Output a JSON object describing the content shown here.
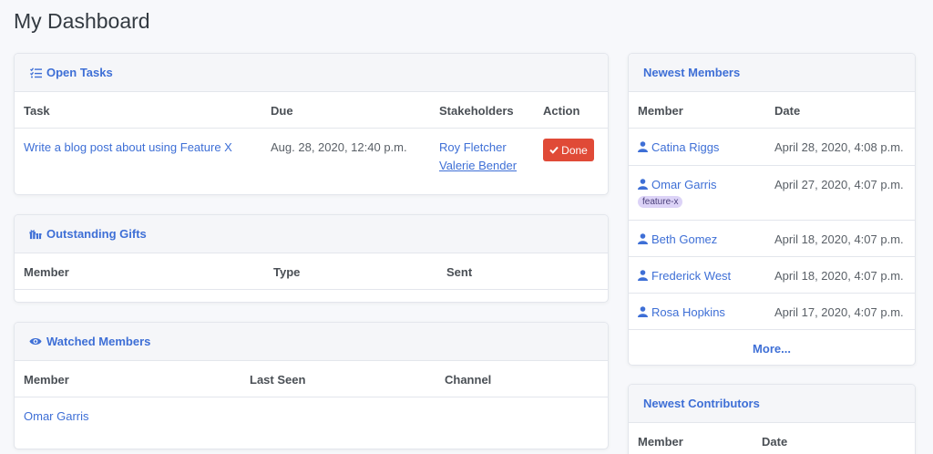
{
  "page": {
    "title": "My Dashboard"
  },
  "open_tasks": {
    "title": "Open Tasks",
    "icon": "tasks-icon",
    "columns": [
      "Task",
      "Due",
      "Stakeholders",
      "Action"
    ],
    "rows": [
      {
        "task": "Write a blog post about using Feature X",
        "due": "Aug. 28, 2020, 12:40 p.m.",
        "stakeholders": [
          "Roy Fletcher",
          "Valerie Bender"
        ],
        "action_label": "Done"
      }
    ]
  },
  "outstanding_gifts": {
    "title": "Outstanding Gifts",
    "icon": "gifts-icon",
    "columns": [
      "Member",
      "Type",
      "Sent"
    ]
  },
  "watched_members": {
    "title": "Watched Members",
    "icon": "eye-icon",
    "columns": [
      "Member",
      "Last Seen",
      "Channel"
    ],
    "rows": [
      {
        "member": "Omar Garris",
        "last_seen": "",
        "channel": ""
      }
    ]
  },
  "newest_members": {
    "title": "Newest Members",
    "columns": [
      "Member",
      "Date"
    ],
    "rows": [
      {
        "member": "Catina Riggs",
        "date": "April 28, 2020, 4:08 p.m.",
        "tag": ""
      },
      {
        "member": "Omar Garris",
        "date": "April 27, 2020, 4:07 p.m.",
        "tag": "feature-x"
      },
      {
        "member": "Beth Gomez",
        "date": "April 18, 2020, 4:07 p.m.",
        "tag": ""
      },
      {
        "member": "Frederick West",
        "date": "April 18, 2020, 4:07 p.m.",
        "tag": ""
      },
      {
        "member": "Rosa Hopkins",
        "date": "April 17, 2020, 4:07 p.m.",
        "tag": ""
      }
    ],
    "more_label": "More..."
  },
  "newest_contributors": {
    "title": "Newest Contributors",
    "columns": [
      "Member",
      "Date"
    ]
  },
  "colors": {
    "accent": "#3e6fd6",
    "danger": "#e04a37",
    "badge": "#dcd3f7"
  }
}
